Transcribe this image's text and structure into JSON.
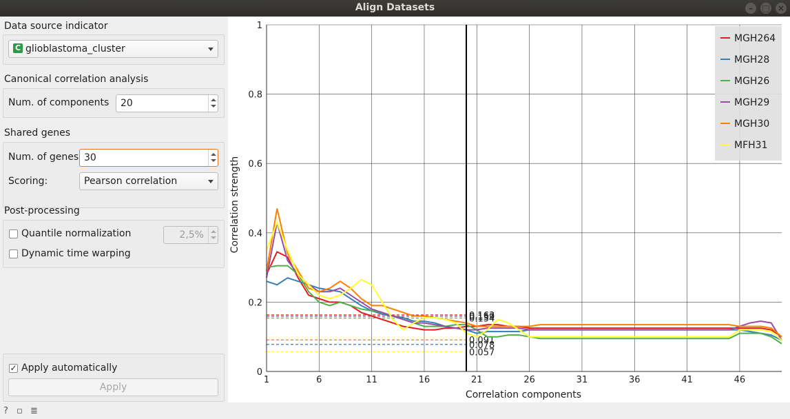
{
  "window": {
    "title": "Align Datasets"
  },
  "data_source": {
    "section": "Data source indicator",
    "selected": "glioblastoma_cluster",
    "icon_letter": "C"
  },
  "cca": {
    "section": "Canonical correlation analysis",
    "components_label": "Num. of components",
    "components_value": "20"
  },
  "shared_genes": {
    "section": "Shared genes",
    "genes_label": "Num. of genes",
    "genes_value": "30",
    "scoring_label": "Scoring:",
    "scoring_value": "Pearson correlation"
  },
  "post_processing": {
    "section": "Post-processing",
    "quantile_label": "Quantile normalization",
    "quantile_value": "2,5%",
    "dtw_label": "Dynamic time warping"
  },
  "apply": {
    "auto_label": "Apply automatically",
    "button_label": "Apply"
  },
  "colors": {
    "MGH264": "#e41a1c",
    "MGH28": "#377eb8",
    "MGH26": "#4daf4a",
    "MGH29": "#984ea3",
    "MGH30": "#ff7f00",
    "MFH31": "#ffff33"
  },
  "chart_data": {
    "type": "line",
    "xlabel": "Correlation components",
    "ylabel": "Correlation strength",
    "xlim": [
      1,
      50
    ],
    "ylim": [
      0,
      1
    ],
    "x_ticks": [
      1,
      6,
      11,
      16,
      21,
      26,
      31,
      36,
      41,
      46
    ],
    "y_ticks": [
      0,
      0.2,
      0.4,
      0.6,
      0.8,
      1
    ],
    "y_tick_labels": [
      "0",
      "0.2",
      "0.4",
      "0.6",
      "0.8",
      "1"
    ],
    "grid": true,
    "legend_position": "top-right",
    "selected_component": 20,
    "series": [
      {
        "name": "MGH264",
        "color": "#e41a1c",
        "values": [
          0.28,
          0.345,
          0.33,
          0.27,
          0.22,
          0.21,
          0.2,
          0.2,
          0.19,
          0.17,
          0.16,
          0.15,
          0.14,
          0.13,
          0.125,
          0.12,
          0.12,
          0.125,
          0.125,
          0.13,
          0.13,
          0.135,
          0.135,
          0.13,
          0.13,
          0.125,
          0.125,
          0.125,
          0.125,
          0.125,
          0.125,
          0.125,
          0.125,
          0.125,
          0.125,
          0.125,
          0.125,
          0.125,
          0.125,
          0.125,
          0.125,
          0.125,
          0.125,
          0.125,
          0.125,
          0.125,
          0.125,
          0.125,
          0.12,
          0.1
        ],
        "threshold": 0.163,
        "threshold_label": "0.163"
      },
      {
        "name": "MGH28",
        "color": "#377eb8",
        "values": [
          0.26,
          0.25,
          0.27,
          0.26,
          0.25,
          0.24,
          0.235,
          0.23,
          0.21,
          0.19,
          0.175,
          0.165,
          0.16,
          0.155,
          0.145,
          0.145,
          0.14,
          0.13,
          0.125,
          0.12,
          0.11,
          0.115,
          0.115,
          0.115,
          0.115,
          0.12,
          0.12,
          0.12,
          0.12,
          0.12,
          0.12,
          0.12,
          0.12,
          0.12,
          0.12,
          0.12,
          0.12,
          0.12,
          0.12,
          0.12,
          0.12,
          0.12,
          0.12,
          0.12,
          0.12,
          0.12,
          0.115,
          0.11,
          0.105,
          0.09
        ],
        "threshold": 0.078,
        "threshold_label": "0.078"
      },
      {
        "name": "MGH26",
        "color": "#4daf4a",
        "values": [
          0.3,
          0.305,
          0.305,
          0.28,
          0.23,
          0.2,
          0.19,
          0.2,
          0.19,
          0.18,
          0.175,
          0.17,
          0.16,
          0.15,
          0.14,
          0.13,
          0.13,
          0.13,
          0.135,
          0.135,
          0.12,
          0.1,
          0.1,
          0.105,
          0.105,
          0.1,
          0.095,
          0.095,
          0.095,
          0.095,
          0.095,
          0.095,
          0.095,
          0.095,
          0.095,
          0.095,
          0.095,
          0.095,
          0.095,
          0.095,
          0.095,
          0.095,
          0.095,
          0.095,
          0.095,
          0.11,
          0.11,
          0.11,
          0.1,
          0.08
        ],
        "threshold": 0.154,
        "threshold_label": "0.154"
      },
      {
        "name": "MGH29",
        "color": "#984ea3",
        "values": [
          0.27,
          0.43,
          0.32,
          0.28,
          0.25,
          0.23,
          0.23,
          0.24,
          0.22,
          0.2,
          0.18,
          0.17,
          0.16,
          0.15,
          0.14,
          0.14,
          0.135,
          0.13,
          0.125,
          0.12,
          0.12,
          0.125,
          0.125,
          0.125,
          0.125,
          0.12,
          0.12,
          0.12,
          0.12,
          0.12,
          0.12,
          0.12,
          0.12,
          0.12,
          0.12,
          0.12,
          0.12,
          0.12,
          0.12,
          0.12,
          0.12,
          0.12,
          0.12,
          0.12,
          0.12,
          0.13,
          0.14,
          0.145,
          0.14,
          0.09
        ],
        "threshold": 0.159,
        "threshold_label": "0.159"
      },
      {
        "name": "MGH30",
        "color": "#ff7f00",
        "values": [
          0.29,
          0.47,
          0.34,
          0.29,
          0.24,
          0.23,
          0.24,
          0.26,
          0.24,
          0.21,
          0.19,
          0.19,
          0.18,
          0.17,
          0.16,
          0.16,
          0.155,
          0.15,
          0.145,
          0.14,
          0.13,
          0.13,
          0.13,
          0.13,
          0.13,
          0.13,
          0.135,
          0.135,
          0.135,
          0.135,
          0.135,
          0.135,
          0.135,
          0.135,
          0.135,
          0.135,
          0.135,
          0.135,
          0.135,
          0.135,
          0.135,
          0.135,
          0.135,
          0.135,
          0.135,
          0.13,
          0.13,
          0.13,
          0.125,
          0.1
        ],
        "threshold": 0.091,
        "threshold_label": "0.091"
      },
      {
        "name": "MFH31",
        "color": "#ffff33",
        "values": [
          0.35,
          0.43,
          0.35,
          0.28,
          0.25,
          0.22,
          0.21,
          0.22,
          0.24,
          0.265,
          0.25,
          0.2,
          0.15,
          0.12,
          0.14,
          0.155,
          0.155,
          0.15,
          0.14,
          0.11,
          0.1,
          0.12,
          0.15,
          0.14,
          0.12,
          0.1,
          0.1,
          0.1,
          0.1,
          0.1,
          0.1,
          0.1,
          0.1,
          0.1,
          0.1,
          0.1,
          0.1,
          0.1,
          0.1,
          0.1,
          0.1,
          0.1,
          0.1,
          0.1,
          0.1,
          0.12,
          0.12,
          0.12,
          0.115,
          0.09
        ],
        "threshold": 0.057,
        "threshold_label": "0.057"
      }
    ]
  }
}
